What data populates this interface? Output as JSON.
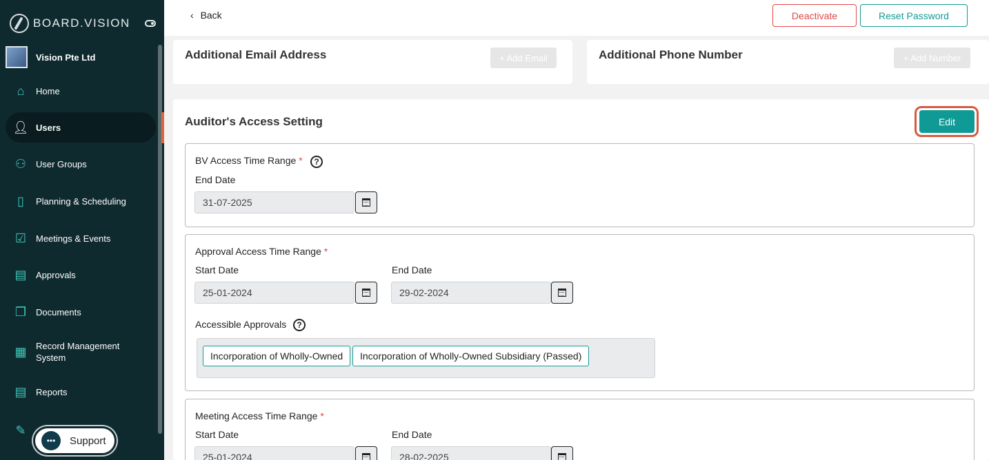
{
  "sidebar": {
    "brand": "BOARD.VISION",
    "org_name": "Vision Pte Ltd",
    "items": [
      {
        "label": "Home",
        "icon": "home-icon"
      },
      {
        "label": "Users",
        "icon": "user-icon"
      },
      {
        "label": "User Groups",
        "icon": "user-groups-icon"
      },
      {
        "label": "Planning & Scheduling",
        "icon": "planning-icon"
      },
      {
        "label": "Meetings & Events",
        "icon": "calendar-check-icon"
      },
      {
        "label": "Approvals",
        "icon": "approvals-icon"
      },
      {
        "label": "Documents",
        "icon": "documents-icon"
      },
      {
        "label": "Record Management System",
        "icon": "records-icon"
      },
      {
        "label": "Reports",
        "icon": "reports-icon"
      }
    ],
    "support_label": "Support"
  },
  "header": {
    "back_label": "Back",
    "deactivate_label": "Deactivate",
    "reset_password_label": "Reset Password"
  },
  "contact": {
    "email_title": "Additional Email Address",
    "add_email_label": "+ Add Email",
    "phone_title": "Additional Phone Number",
    "add_number_label": "+ Add Number"
  },
  "access": {
    "title": "Auditor's Access Setting",
    "edit_label": "Edit",
    "bv": {
      "label": "BV Access Time Range",
      "required": "*",
      "help": "?",
      "end_label": "End Date",
      "end_value": "31-07-2025"
    },
    "approval": {
      "label": "Approval Access Time Range",
      "required": "*",
      "start_label": "Start Date",
      "start_value": "25-01-2024",
      "end_label": "End Date",
      "end_value": "29-02-2024",
      "accessible_label": "Accessible Approvals",
      "help": "?",
      "tags": [
        "Incorporation of Wholly-Owned",
        "Incorporation of Wholly-Owned Subsidiary (Passed)"
      ]
    },
    "meeting": {
      "label": "Meeting Access Time Range",
      "required": "*",
      "start_label": "Start Date",
      "start_value": "25-01-2024",
      "end_label": "End Date",
      "end_value": "28-02-2025"
    }
  },
  "colors": {
    "sidebar_bg": "#0f2a2f",
    "accent_teal": "#0f9a95",
    "danger_red": "#e04848",
    "highlight_ring": "#d75a40"
  }
}
